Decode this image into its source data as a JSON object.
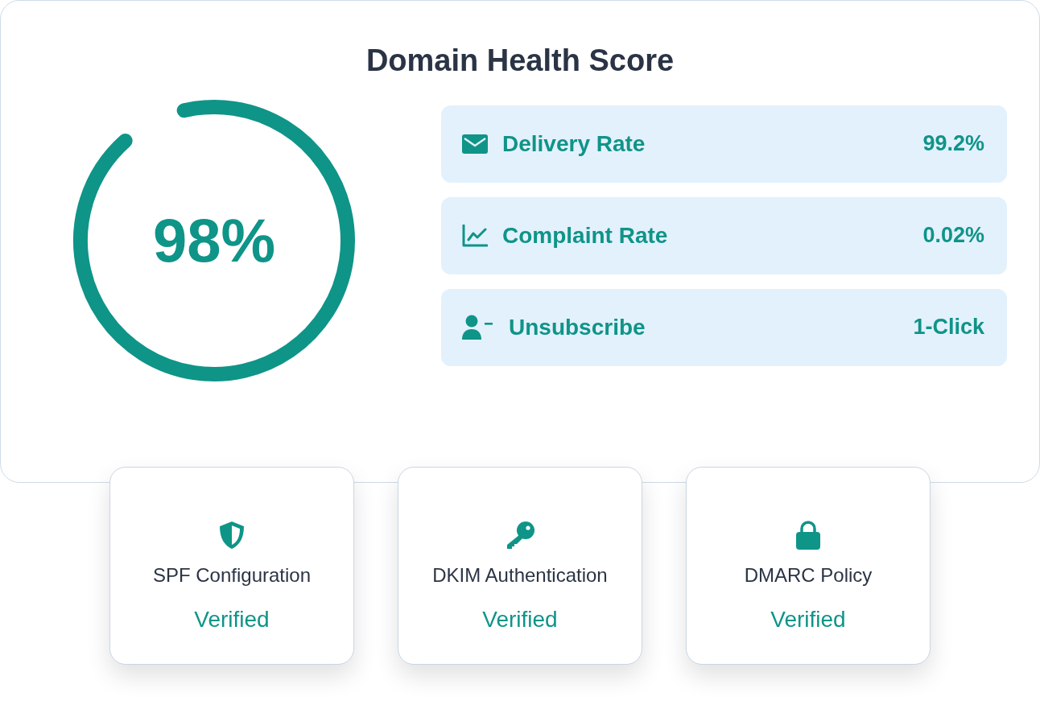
{
  "title": "Domain Health Score",
  "score": {
    "value": "98%",
    "level": 0.92
  },
  "metrics": [
    {
      "label": "Delivery Rate",
      "value": "99.2%"
    },
    {
      "label": "Complaint Rate",
      "value": "0.02%"
    },
    {
      "label": "Unsubscribe",
      "value": "1-Click"
    }
  ],
  "checks": [
    {
      "label": "SPF Configuration",
      "status": "Verified"
    },
    {
      "label": "DKIM Authentication",
      "status": "Verified"
    },
    {
      "label": "DMARC Policy",
      "status": "Verified"
    }
  ]
}
